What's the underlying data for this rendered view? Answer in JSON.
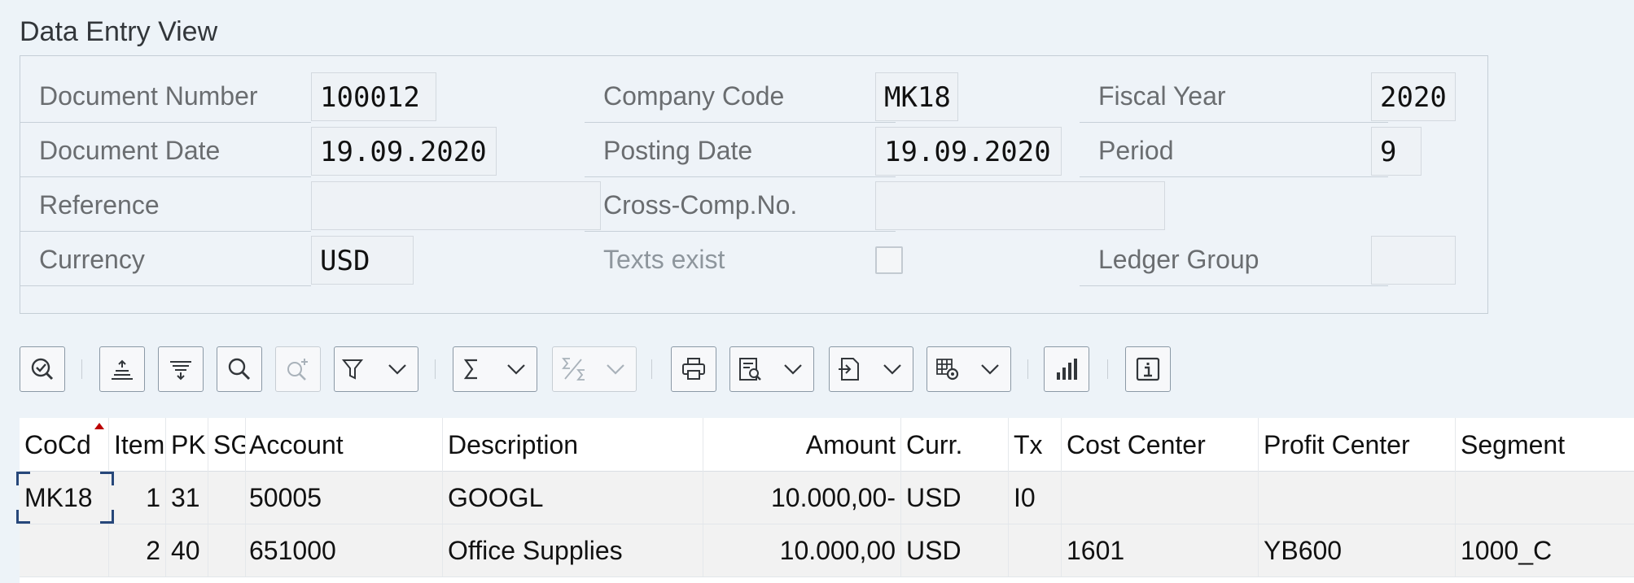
{
  "view_title": "Data Entry View",
  "header": {
    "document_number": {
      "label": "Document Number",
      "value": "100012"
    },
    "company_code": {
      "label": "Company Code",
      "value": "MK18"
    },
    "fiscal_year": {
      "label": "Fiscal Year",
      "value": "2020"
    },
    "document_date": {
      "label": "Document Date",
      "value": "19.09.2020"
    },
    "posting_date": {
      "label": "Posting Date",
      "value": "19.09.2020"
    },
    "period": {
      "label": "Period",
      "value": "9"
    },
    "reference": {
      "label": "Reference",
      "value": ""
    },
    "cross_comp_no": {
      "label": "Cross-Comp.No.",
      "value": ""
    },
    "currency": {
      "label": "Currency",
      "value": "USD"
    },
    "texts_exist": {
      "label": "Texts exist",
      "checked": false
    },
    "ledger_group": {
      "label": "Ledger Group",
      "value": ""
    }
  },
  "toolbar": {
    "buttons": [
      "details-icon",
      "sort-ascending-icon",
      "sort-descending-icon",
      "search-icon",
      "search-next-icon",
      "filter-icon",
      "sum-icon",
      "subtotal-icon",
      "print-icon",
      "print-preview-icon",
      "export-icon",
      "layout-settings-icon",
      "chart-icon",
      "info-icon"
    ]
  },
  "grid": {
    "columns": [
      "CoCd",
      "Item",
      "PK",
      "SG",
      "Account",
      "Description",
      "Amount",
      "Curr.",
      "Tx",
      "Cost Center",
      "Profit Center",
      "Segment"
    ],
    "rows": [
      {
        "cocd": "MK18",
        "item": "1",
        "pk": "31",
        "sg": "",
        "account": "50005",
        "description": "GOOGL",
        "amount": "10.000,00-",
        "curr": "USD",
        "tx": "I0",
        "cost_center": "",
        "profit_center": "",
        "segment": ""
      },
      {
        "cocd": "",
        "item": "2",
        "pk": "40",
        "sg": "",
        "account": "651000",
        "description": "Office Supplies",
        "amount": "10.000,00",
        "curr": "USD",
        "tx": "",
        "cost_center": "1601",
        "profit_center": "YB600",
        "segment": "1000_C"
      }
    ]
  },
  "colors": {
    "accent": "#0a6ed1",
    "icon": "#32363a",
    "background": "#edf3f8",
    "sort_marker": "#bb0000"
  }
}
